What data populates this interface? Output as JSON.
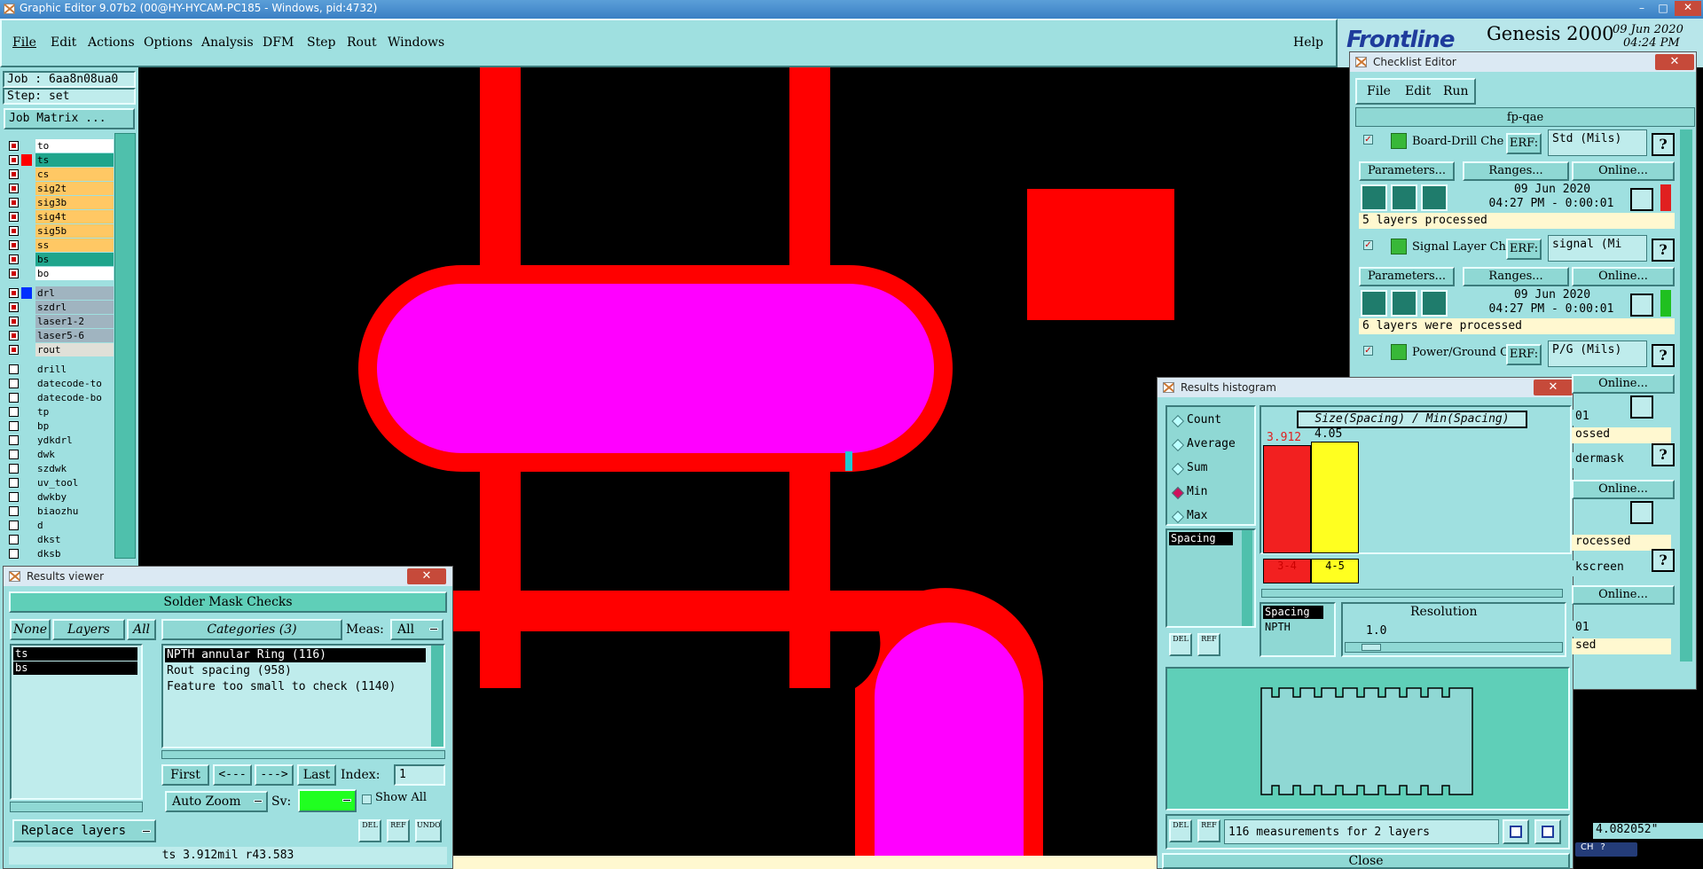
{
  "app": {
    "title": "Graphic Editor 9.07b2 (00@HY-HYCAM-PC185 - Windows, pid:4732)"
  },
  "menu": {
    "items": [
      "File",
      "Edit",
      "Actions",
      "Options",
      "Analysis",
      "DFM",
      "Step",
      "Rout",
      "Windows"
    ],
    "help": "Help"
  },
  "brand": {
    "logo": "Frontline",
    "product": "Genesis 2000",
    "date": "09 Jun 2020",
    "time": "04:24 PM"
  },
  "job": {
    "job_label": "Job : 6aa8n08ua0",
    "step_label": "Step: set",
    "matrix_button": "Job Matrix ..."
  },
  "layers": [
    {
      "name": "to",
      "color": "#ffffff",
      "active": false
    },
    {
      "name": "ts",
      "color": "#1fa58c",
      "active": true
    },
    {
      "name": "cs",
      "color": "#ffc864",
      "active": false
    },
    {
      "name": "sig2t",
      "color": "#ffc864",
      "active": false
    },
    {
      "name": "sig3b",
      "color": "#ffc864",
      "active": false
    },
    {
      "name": "sig4t",
      "color": "#ffc864",
      "active": false
    },
    {
      "name": "sig5b",
      "color": "#ffc864",
      "active": false
    },
    {
      "name": "ss",
      "color": "#ffc864",
      "active": false
    },
    {
      "name": "bs",
      "color": "#1fa58c",
      "active": false
    },
    {
      "name": "bo",
      "color": "#ffffff",
      "active": false
    },
    {
      "name": "drl",
      "color": "#a0b4c0",
      "active": true
    },
    {
      "name": "szdrl",
      "color": "#a0b4c0",
      "active": false
    },
    {
      "name": "laser1-2",
      "color": "#a0b4c0",
      "active": false
    },
    {
      "name": "laser5-6",
      "color": "#a0b4c0",
      "active": false
    },
    {
      "name": "rout",
      "color": "#e0e0d8",
      "active": false
    },
    {
      "name": "drill",
      "color": "#9fe0e0",
      "active": false
    },
    {
      "name": "datecode-to",
      "color": "#9fe0e0",
      "active": false
    },
    {
      "name": "datecode-bo",
      "color": "#9fe0e0",
      "active": false
    },
    {
      "name": "tp",
      "color": "#9fe0e0",
      "active": false
    },
    {
      "name": "bp",
      "color": "#9fe0e0",
      "active": false
    },
    {
      "name": "ydkdrl",
      "color": "#9fe0e0",
      "active": false
    },
    {
      "name": "dwk",
      "color": "#9fe0e0",
      "active": false
    },
    {
      "name": "szdwk",
      "color": "#9fe0e0",
      "active": false
    },
    {
      "name": "uv_tool",
      "color": "#9fe0e0",
      "active": false
    },
    {
      "name": "dwkby",
      "color": "#9fe0e0",
      "active": false
    },
    {
      "name": "biaozhu",
      "color": "#9fe0e0",
      "active": false
    },
    {
      "name": "d",
      "color": "#9fe0e0",
      "active": false
    },
    {
      "name": "dkst",
      "color": "#9fe0e0",
      "active": false
    },
    {
      "name": "dksb",
      "color": "#9fe0e0",
      "active": false
    }
  ],
  "results_viewer": {
    "title": "Results viewer",
    "header": "Solder Mask Checks",
    "none": "None",
    "layers": "Layers",
    "all": "All",
    "categories": "Categories (3)",
    "meas_label": "Meas:",
    "meas_value": "All",
    "layer_list": [
      "ts",
      "bs"
    ],
    "category_list": [
      "NPTH annular Ring (116)",
      "Rout spacing (958)",
      "Feature too small to check (1140)"
    ],
    "first": "First",
    "prev": "<---",
    "next": "--->",
    "last": "Last",
    "index_label": "Index:",
    "index_value": "1",
    "auto_zoom": "Auto Zoom",
    "sv_label": "Sv:",
    "show_all": "Show All",
    "del": "DEL",
    "ref": "REF",
    "undo": "UNDO",
    "replace_layers": "Replace layers",
    "status": "ts 3.912mil   r43.583"
  },
  "checklist": {
    "title": "Checklist Editor",
    "menu": [
      "File",
      "Edit",
      "Run"
    ],
    "name": "fp-qae",
    "checks": [
      {
        "title": "Board-Drill Che",
        "erf": "ERF:",
        "erf_value": "Std (Mils)",
        "date": "09 Jun 2020",
        "time": "04:27 PM - 0:00:01",
        "status": "5 layers processed",
        "flag": "#e02020"
      },
      {
        "title": "Signal Layer Ch",
        "erf": "ERF:",
        "erf_value": "signal (Mi",
        "date": "09 Jun 2020",
        "time": "04:27 PM - 0:00:01",
        "status": "6 layers were processed",
        "flag": "#20c020"
      },
      {
        "title": "Power/Ground C",
        "erf": "ERF:",
        "erf_value": "P/G (Mils)"
      }
    ],
    "partial": [
      "01",
      "ossed",
      "dermask",
      "rocessed",
      "kscreen",
      "01",
      "sed"
    ],
    "params": "Parameters...",
    "ranges": "Ranges...",
    "online": "Online..."
  },
  "histogram": {
    "title": "Results histogram",
    "modes": [
      "Count",
      "Average",
      "Sum",
      "Min",
      "Max"
    ],
    "selected_mode": "Min",
    "chart_title": "Size(Spacing) / Min(Spacing)",
    "bars": [
      {
        "label": "3-4",
        "value": 3.912,
        "value_text": "3.912",
        "color": "#f22020"
      },
      {
        "label": "4-5",
        "value": 4.05,
        "value_text": "4.05",
        "color": "#ffff20"
      }
    ],
    "list_item": "Spacing",
    "attr_items": [
      "Spacing",
      "NPTH"
    ],
    "resolution_label": "Resolution",
    "resolution_value": "1.0",
    "measurements": "116 measurements for 2 layers",
    "del": "DEL",
    "ref": "REF",
    "close": "Close"
  },
  "coord": {
    "value": "4.082052\""
  },
  "ime": {
    "label": "CH"
  },
  "colors": {
    "panel": "#9fe0e0",
    "pcb_red": "#ff0000",
    "pcb_magenta": "#ff00ff",
    "dark_teal": "#5fcfb8"
  }
}
